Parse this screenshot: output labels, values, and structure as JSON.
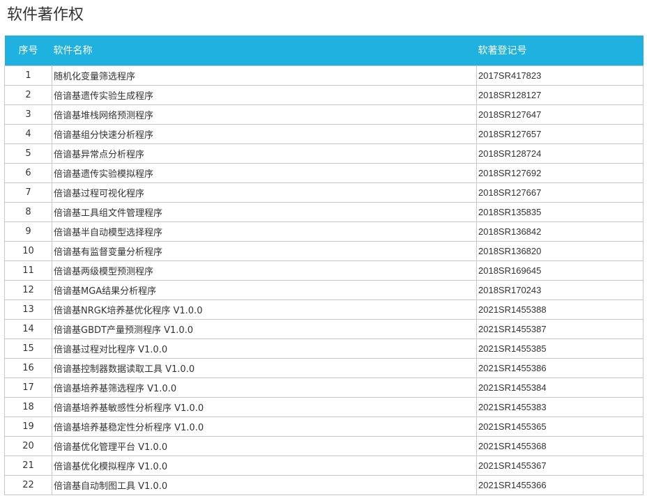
{
  "page": {
    "title": "软件著作权"
  },
  "table": {
    "headers": {
      "index": "序号",
      "name": "软件名称",
      "registration": "软著登记号"
    },
    "rows": [
      {
        "index": "1",
        "name": "随机化变量筛选程序",
        "registration": "2017SR417823"
      },
      {
        "index": "2",
        "name": "倍谙基遗传实验生成程序",
        "registration": "2018SR128127"
      },
      {
        "index": "3",
        "name": "倍谙基堆栈网络预测程序",
        "registration": "2018SR127647"
      },
      {
        "index": "4",
        "name": "倍谙基组分快速分析程序",
        "registration": "2018SR127657"
      },
      {
        "index": "5",
        "name": "倍谙基异常点分析程序",
        "registration": "2018SR128724"
      },
      {
        "index": "6",
        "name": "倍谙基遗传实验模拟程序",
        "registration": "2018SR127692"
      },
      {
        "index": "7",
        "name": "倍谙基过程可视化程序",
        "registration": "2018SR127667"
      },
      {
        "index": "8",
        "name": "倍谙基工具组文件管理程序",
        "registration": "2018SR135835"
      },
      {
        "index": "9",
        "name": "倍谙基半自动模型选择程序",
        "registration": "2018SR136842"
      },
      {
        "index": "10",
        "name": "倍谙基有监督变量分析程序",
        "registration": "2018SR136820"
      },
      {
        "index": "11",
        "name": "倍谙基两级模型预测程序",
        "registration": "2018SR169645"
      },
      {
        "index": "12",
        "name": "倍谙基MGA结果分析程序",
        "registration": "2018SR170243"
      },
      {
        "index": "13",
        "name": "倍谙基NRGK培养基优化程序 V1.0.0",
        "registration": "2021SR1455388"
      },
      {
        "index": "14",
        "name": "倍谙基GBDT产量预测程序 V1.0.0",
        "registration": "2021SR1455387"
      },
      {
        "index": "15",
        "name": "倍谙基过程对比程序 V1.0.0",
        "registration": "2021SR1455385"
      },
      {
        "index": "16",
        "name": "倍谙基控制器数据读取工具 V1.0.0",
        "registration": "2021SR1455386"
      },
      {
        "index": "17",
        "name": "倍谙基培养基筛选程序 V1.0.0",
        "registration": "2021SR1455384"
      },
      {
        "index": "18",
        "name": "倍谙基培养基敏感性分析程序 V1.0.0",
        "registration": "2021SR1455383"
      },
      {
        "index": "19",
        "name": "倍谙基培养基稳定性分析程序 V1.0.0",
        "registration": "2021SR1455365"
      },
      {
        "index": "20",
        "name": "倍谙基优化管理平台 V1.0.0",
        "registration": "2021SR1455368"
      },
      {
        "index": "21",
        "name": "倍谙基优化模拟程序 V1.0.0",
        "registration": "2021SR1455367"
      },
      {
        "index": "22",
        "name": "倍谙基自动制图工具 V1.0.0",
        "registration": "2021SR1455366"
      }
    ]
  },
  "colors": {
    "header_bg": "#1fb2e0",
    "header_text": "#ffffff",
    "border": "#c8c8c8",
    "text": "#333333"
  }
}
